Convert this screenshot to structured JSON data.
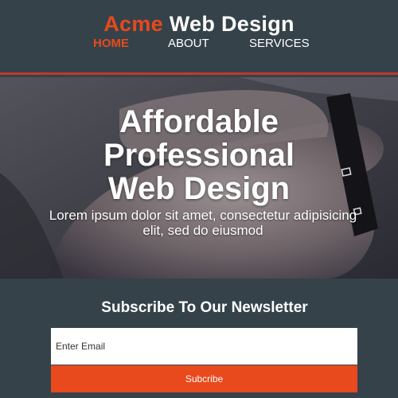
{
  "header": {
    "logo_accent": "Acme",
    "logo_rest": " Web Design",
    "nav": [
      {
        "label": "HOME",
        "active": true
      },
      {
        "label": "ABOUT",
        "active": false
      },
      {
        "label": "SERVICES",
        "active": false
      }
    ]
  },
  "hero": {
    "title_line1": "Affordable",
    "title_line2": "Professional",
    "title_line3": "Web Design",
    "subtitle": "Lorem ipsum dolor sit amet, consectetur adipisicing elit, sed do eiusmod"
  },
  "newsletter": {
    "title": "Subscribe To Our Newsletter",
    "email_placeholder": "Enter Email",
    "button_label": "Subcribe"
  },
  "colors": {
    "background": "#35424a",
    "accent": "#e8491d",
    "header_border": "#c0392b",
    "text": "#ffffff"
  }
}
